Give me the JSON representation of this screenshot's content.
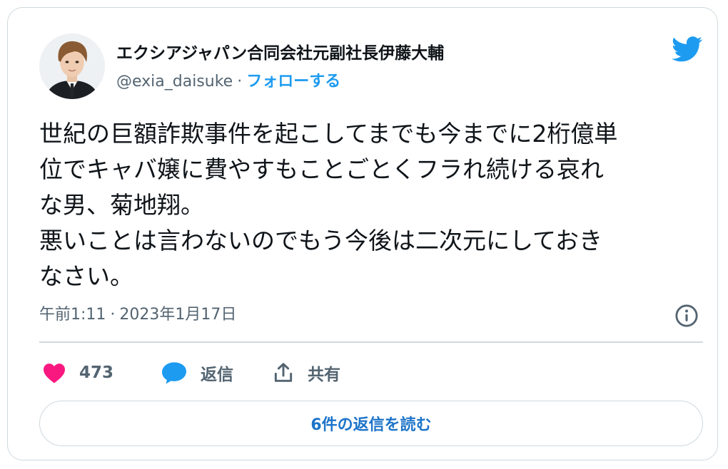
{
  "author": {
    "display_name": "エクシアジャパン合同会社元副社長伊藤大輔",
    "handle": "@exia_daisuke",
    "separator": "·",
    "follow_label": "フォローする"
  },
  "tweet": {
    "text": "世紀の巨額詐欺事件を起こしてまでも今までに2桁億単\n位でキャバ嬢に費やすもことごとくフラれ続ける哀れ\nな男、菊地翔。\n悪いことは言わないのでもう今後は二次元にしておき\nなさい。",
    "time": "午前1:11",
    "separator": "·",
    "date": "2023年1月17日"
  },
  "actions": {
    "like_count": "473",
    "reply_label": "返信",
    "share_label": "共有"
  },
  "read_replies_label": "6件の返信を読む",
  "icons": {
    "brand": "twitter-bird-icon",
    "info": "info-icon",
    "like": "heart-icon",
    "reply": "speech-bubble-icon",
    "share": "share-upload-icon"
  },
  "colors": {
    "accent": "#1d9bf0",
    "like": "#f91880",
    "muted": "#536471",
    "border": "#cfd9de"
  }
}
